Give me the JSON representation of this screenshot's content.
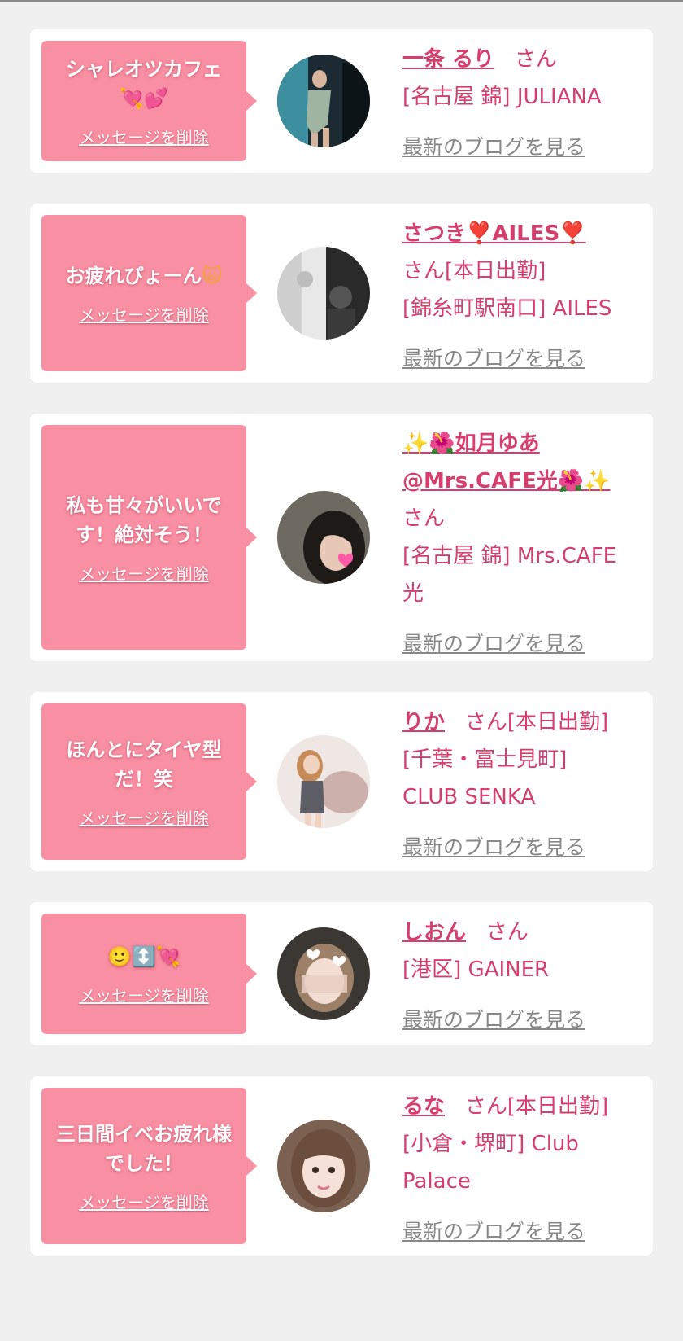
{
  "delete_label": "メッセージを削除",
  "blog_label": "最新のブログを見る",
  "suffix_san": "さん",
  "colors": {
    "background": "#f0f0f0",
    "bubble": "#f98fa2",
    "name_text": "#d63e6e",
    "link_gray": "#888888"
  },
  "messages": [
    {
      "message": "シャレオツカフェ",
      "message_emoji": "💘💕",
      "name": "一条 るり",
      "suffix": "さん",
      "shop": "[名古屋 錦] JULIANA"
    },
    {
      "message": "お疲れぴょーん",
      "message_emoji": "🙀",
      "name": "さつき❣️AILES❣️",
      "suffix": "さん[本日出勤]",
      "shop": "[錦糸町駅南口] AILES"
    },
    {
      "message": "私も甘々がいいです！絶対そう！",
      "name": "✨🌺如月ゆあ@Mrs.CAFE光🌺✨",
      "suffix": "さん",
      "shop": "[名古屋 錦] Mrs.CAFE光"
    },
    {
      "message": "ほんとにタイヤ型だ！笑",
      "name": "りか",
      "suffix": "さん[本日出勤]",
      "shop": "[千葉・富士見町] CLUB SENKA"
    },
    {
      "message": "🙂↕️💘",
      "name": "しおん",
      "suffix": "さん",
      "shop": "[港区] GAINER"
    },
    {
      "message": "三日間イベお疲れ様でした！",
      "name": "るな",
      "suffix": "さん[本日出勤]",
      "shop": "[小倉・堺町] Club Palace"
    }
  ]
}
